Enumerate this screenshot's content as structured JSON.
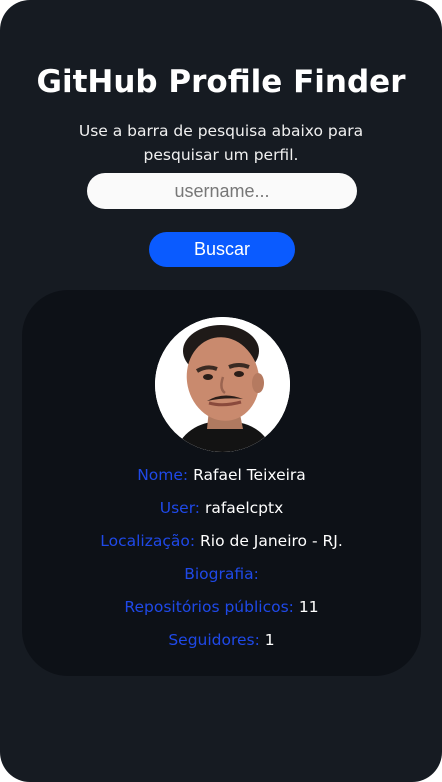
{
  "header": {
    "title": "GitHub Profile Finder",
    "subtitle": "Use a barra de pesquisa abaixo para pesquisar um perfil."
  },
  "search": {
    "placeholder": "username...",
    "value": "",
    "button_label": "Buscar"
  },
  "profile": {
    "avatar_icon": "user-photo",
    "fields": {
      "name": {
        "label": "Nome:",
        "value": "Rafael Teixeira"
      },
      "user": {
        "label": "User:",
        "value": "rafaelcptx"
      },
      "location": {
        "label": "Localização:",
        "value": "Rio de Janeiro - RJ."
      },
      "bio": {
        "label": "Biografia:",
        "value": ""
      },
      "repos": {
        "label": "Repositórios públicos:",
        "value": "11"
      },
      "followers": {
        "label": "Seguidores:",
        "value": "1"
      }
    }
  },
  "colors": {
    "background": "#161b22",
    "card": "#0d1117",
    "accent": "#0a5bff",
    "label": "#1f49e8"
  }
}
